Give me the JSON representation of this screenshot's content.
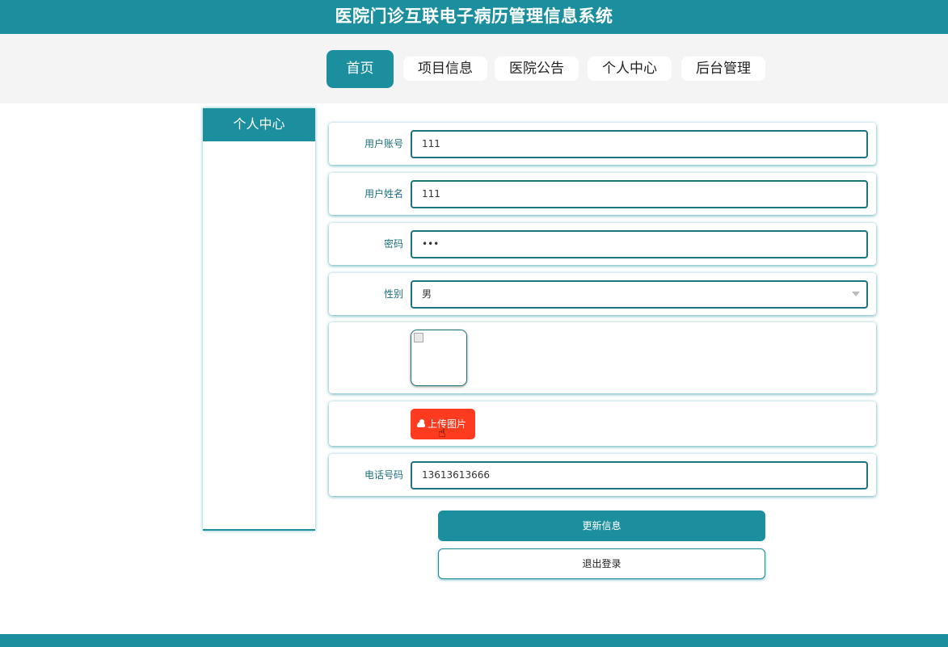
{
  "app_title": "医院门诊互联电子病历管理信息系统",
  "nav": {
    "items": [
      {
        "label": "首页",
        "active": true
      },
      {
        "label": "项目信息",
        "active": false
      },
      {
        "label": "医院公告",
        "active": false
      },
      {
        "label": "个人中心",
        "active": false
      },
      {
        "label": "后台管理",
        "active": false
      }
    ]
  },
  "sidebar": {
    "title": "个人中心"
  },
  "form": {
    "account": {
      "label": "用户账号",
      "value": "111"
    },
    "name": {
      "label": "用户姓名",
      "value": "111"
    },
    "password": {
      "label": "密码",
      "value": "•••"
    },
    "gender": {
      "label": "性别",
      "value": "男"
    },
    "upload_label": "上传图片",
    "phone": {
      "label": "电话号码",
      "value": "13613613666"
    }
  },
  "buttons": {
    "update": "更新信息",
    "logout": "退出登录"
  },
  "colors": {
    "primary": "#1c8f9e",
    "upload": "#ff3b1f",
    "nav_band": "#f4f4f4"
  },
  "icons": {
    "upload": "cloud-upload-icon",
    "select": "chevron-down-icon",
    "cursor": "hand-pointer-icon"
  }
}
